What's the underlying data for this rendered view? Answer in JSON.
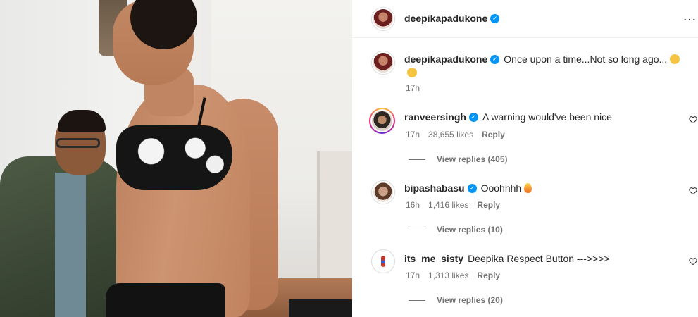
{
  "post": {
    "username": "deepikapadukone",
    "more_icon": "…"
  },
  "caption": {
    "username": "deepikapadukone",
    "text": "Once upon a time...Not so long ago...",
    "time": "17h"
  },
  "comments": [
    {
      "username": "ranveersingh",
      "text": "A warning would've been nice",
      "time": "17h",
      "likes": "38,655 likes",
      "reply_label": "Reply",
      "view_replies": "View replies (405)"
    },
    {
      "username": "bipashabasu",
      "text": "Ooohhhh",
      "time": "16h",
      "likes": "1,416 likes",
      "reply_label": "Reply",
      "view_replies": "View replies (10)"
    },
    {
      "username": "its_me_sisty",
      "text": "Deepika Respect Button --->>>>",
      "time": "17h",
      "likes": "1,313 likes",
      "reply_label": "Reply",
      "view_replies": "View replies (20)"
    }
  ],
  "colors": {
    "verified": "#0095f6",
    "secondary_text": "#737373",
    "primary_text": "#262626"
  }
}
